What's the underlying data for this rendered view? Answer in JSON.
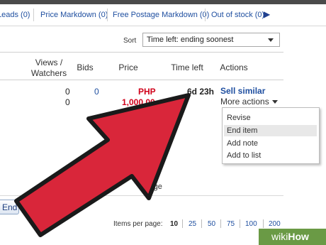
{
  "filters": {
    "leads": "Leads (0)",
    "price_markdown": "Price Markdown (0)",
    "free_postage": "Free Postage Markdown (0)",
    "out_of_stock": "Out of stock (0)"
  },
  "sort": {
    "label": "Sort",
    "value": "Time left: ending soonest"
  },
  "columns": {
    "views_watchers": "Views /",
    "views_watchers2": "Watchers",
    "bids": "Bids",
    "price": "Price",
    "time_left": "Time left",
    "actions": "Actions"
  },
  "row": {
    "views": "0",
    "watchers": "0",
    "bids": "0",
    "currency": "PHP",
    "price": "1,000.00",
    "time_left": "6d 23h",
    "sell_similar": "Sell similar",
    "more_actions": "More actions"
  },
  "menu": {
    "items": [
      "Revise",
      "End item",
      "Add note",
      "Add to list"
    ]
  },
  "partial": {
    "price_fragment": "00",
    "postage_fragment": "stage"
  },
  "end_button": "End",
  "pagination": {
    "label": "Items per page:",
    "options": [
      "10",
      "25",
      "50",
      "75",
      "100",
      "200"
    ],
    "current": "10"
  },
  "watermark": {
    "wiki": "wiki",
    "how": "How"
  },
  "colors": {
    "arrow": "#d9263a",
    "link": "#1f4fa0",
    "price": "#d0021b",
    "watermark": "#6a9a45"
  }
}
